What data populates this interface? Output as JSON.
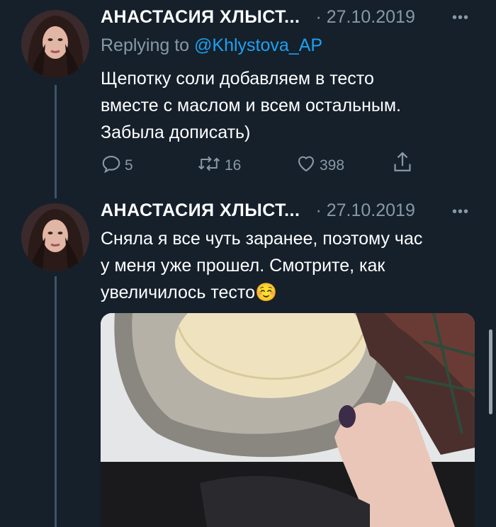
{
  "tweets": [
    {
      "name": "АНАСТАСИЯ ХЛЫСТ...",
      "date": "· 27.10.2019",
      "more": "•••",
      "reply_prefix": "Replying to",
      "reply_handle": "@Khlystova_AP",
      "text_lines": [
        "Щепотку соли добавляем в тесто",
        "вместе с маслом и всем остальным.",
        "Забыла дописать)"
      ],
      "actions": {
        "replies": "5",
        "retweets": "16",
        "likes": "398"
      }
    },
    {
      "name": "АНАСТАСИЯ ХЛЫСТ...",
      "date": "· 27.10.2019",
      "more": "•••",
      "text_lines": [
        "Сняла я все чуть заранее, поэтому час",
        "у меня уже прошел. Смотрите, как",
        "увеличилось тесто☺️"
      ]
    }
  ],
  "icons": [
    "reply-icon",
    "retweet-icon",
    "like-icon",
    "share-icon"
  ],
  "colors": {
    "background": "#15202b",
    "muted": "#8899a6",
    "link": "#1da1f2"
  }
}
